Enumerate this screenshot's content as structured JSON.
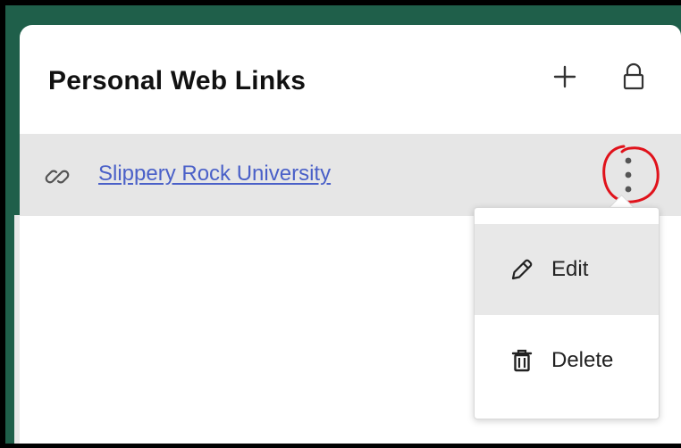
{
  "panel": {
    "title": "Personal Web Links",
    "actions": {
      "add_icon": "plus-icon",
      "lock_icon": "lock-icon"
    }
  },
  "links": [
    {
      "label": "Slippery Rock University",
      "icon": "link-icon",
      "menu_icon": "kebab-icon"
    }
  ],
  "menu": {
    "items": [
      {
        "label": "Edit",
        "icon": "pencil-icon"
      },
      {
        "label": "Delete",
        "icon": "trash-icon"
      }
    ]
  },
  "colors": {
    "link": "#4a60c8",
    "accent_bg": "#1f5f4a",
    "row_bg": "#e6e6e6",
    "highlight": "#e8e8e8",
    "annotation_red": "#e0121b"
  }
}
